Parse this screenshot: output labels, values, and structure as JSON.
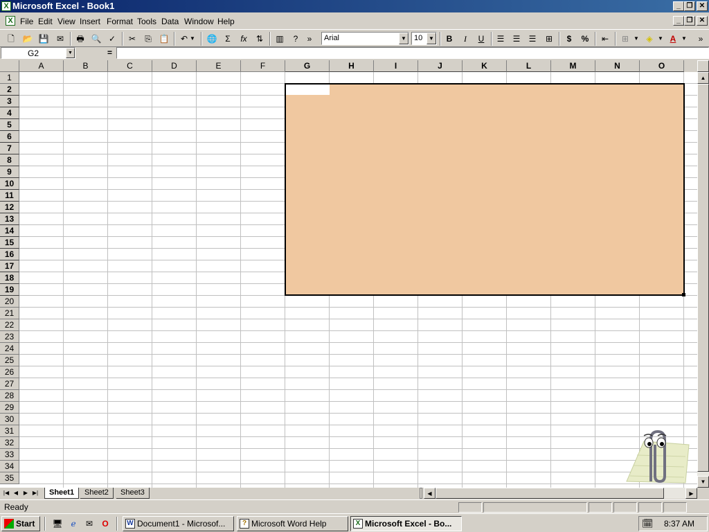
{
  "window": {
    "title": "Microsoft Excel - Book1",
    "app_icon": "excel-icon"
  },
  "caption_buttons": [
    "_",
    "❐",
    "✕"
  ],
  "menu": [
    "File",
    "Edit",
    "View",
    "Insert",
    "Format",
    "Tools",
    "Data",
    "Window",
    "Help"
  ],
  "toolbar": {
    "font_name": "Arial",
    "font_size": "10",
    "bold": "B",
    "italic": "I",
    "underline": "U",
    "currency": "$",
    "percent": "%",
    "autosum": "Σ",
    "function": "fx"
  },
  "formula_bar": {
    "name_box": "G2",
    "equals": "=",
    "formula": ""
  },
  "columns": [
    "A",
    "B",
    "C",
    "D",
    "E",
    "F",
    "G",
    "H",
    "I",
    "J",
    "K",
    "L",
    "M",
    "N",
    "O"
  ],
  "rows": [
    "1",
    "2",
    "3",
    "4",
    "5",
    "6",
    "7",
    "8",
    "9",
    "10",
    "11",
    "12",
    "13",
    "14",
    "15",
    "16",
    "17",
    "18",
    "19",
    "20",
    "21",
    "22",
    "23",
    "24",
    "25",
    "26",
    "27",
    "28",
    "29",
    "30",
    "31",
    "32",
    "33",
    "34",
    "35"
  ],
  "selection": {
    "range": "G2:O19",
    "active_cell": "G2",
    "fill_color": "#f0c8a0"
  },
  "sheet_tabs": [
    "Sheet1",
    "Sheet2",
    "Sheet3"
  ],
  "active_sheet": "Sheet1",
  "status": {
    "text": "Ready"
  },
  "taskbar": {
    "start": "Start",
    "tasks": [
      "Document1 - Microsof...",
      "Microsoft Word Help",
      "Microsoft Excel - Bo..."
    ],
    "active_task": 2,
    "clock": "8:37 AM"
  }
}
